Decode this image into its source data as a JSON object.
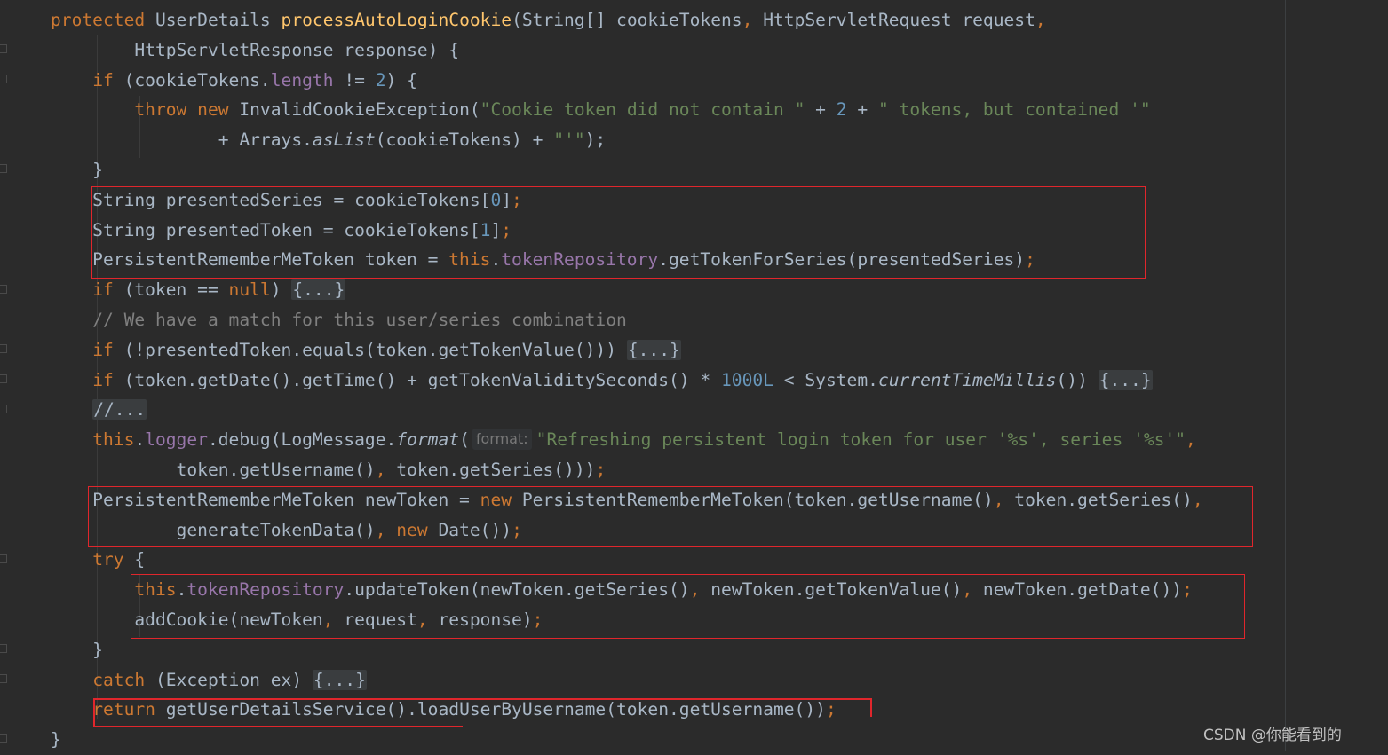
{
  "editor": {
    "lines": [
      [
        [
          "kw",
          "protected "
        ],
        [
          "pl",
          "UserDetails "
        ],
        [
          "fn",
          "processAutoLoginCookie"
        ],
        [
          "pl",
          "(String[] cookieTokens"
        ],
        [
          "kw",
          ", "
        ],
        [
          "pl",
          "HttpServletRequest request"
        ],
        [
          "kw",
          ","
        ]
      ],
      [
        [
          "pl",
          "        HttpServletResponse response) {"
        ]
      ],
      [
        [
          "pl",
          "    "
        ],
        [
          "kw",
          "if "
        ],
        [
          "pl",
          "(cookieTokens."
        ],
        [
          "fld",
          "length "
        ],
        [
          "pl",
          "!= "
        ],
        [
          "num",
          "2"
        ],
        [
          "pl",
          ") {"
        ]
      ],
      [
        [
          "pl",
          "        "
        ],
        [
          "kw",
          "throw new "
        ],
        [
          "pl",
          "InvalidCookieException("
        ],
        [
          "str",
          "\"Cookie token did not contain \" "
        ],
        [
          "pl",
          "+ "
        ],
        [
          "num",
          "2 "
        ],
        [
          "pl",
          "+ "
        ],
        [
          "str",
          "\" tokens, but contained '\""
        ]
      ],
      [
        [
          "pl",
          "                + Arrays."
        ],
        [
          "it",
          "asList"
        ],
        [
          "pl",
          "(cookieTokens) + "
        ],
        [
          "str",
          "\"'\""
        ],
        [
          "pl",
          ");"
        ]
      ],
      [
        [
          "pl",
          "    }"
        ]
      ],
      [
        [
          "pl",
          "    String presentedSeries = cookieTokens["
        ],
        [
          "num",
          "0"
        ],
        [
          "pl",
          "]"
        ],
        [
          "kw",
          ";"
        ]
      ],
      [
        [
          "pl",
          "    String presentedToken = cookieTokens["
        ],
        [
          "num",
          "1"
        ],
        [
          "pl",
          "]"
        ],
        [
          "kw",
          ";"
        ]
      ],
      [
        [
          "pl",
          "    PersistentRememberMeToken token = "
        ],
        [
          "kw",
          "this"
        ],
        [
          "pl",
          "."
        ],
        [
          "fld",
          "tokenRepository"
        ],
        [
          "pl",
          ".getTokenForSeries(presentedSeries)"
        ],
        [
          "kw",
          ";"
        ]
      ],
      [
        [
          "pl",
          "    "
        ],
        [
          "kw",
          "if "
        ],
        [
          "pl",
          "(token == "
        ],
        [
          "kw",
          "null"
        ],
        [
          "pl",
          ") "
        ],
        [
          "fold",
          "{...}"
        ]
      ],
      [
        [
          "pl",
          "    "
        ],
        [
          "cmt",
          "// We have a match for this user/series combination"
        ]
      ],
      [
        [
          "pl",
          "    "
        ],
        [
          "kw",
          "if "
        ],
        [
          "pl",
          "(!presentedToken.equals(token.getTokenValue())) "
        ],
        [
          "fold",
          "{...}"
        ]
      ],
      [
        [
          "pl",
          "    "
        ],
        [
          "kw",
          "if "
        ],
        [
          "pl",
          "(token.getDate().getTime() + getTokenValiditySeconds() * "
        ],
        [
          "num",
          "1000L "
        ],
        [
          "pl",
          "< System."
        ],
        [
          "it",
          "currentTimeMillis"
        ],
        [
          "pl",
          "()) "
        ],
        [
          "fold",
          "{...}"
        ]
      ],
      [
        [
          "pl",
          "    "
        ],
        [
          "fold",
          "//..."
        ]
      ],
      [
        [
          "pl",
          "    "
        ],
        [
          "kw",
          "this"
        ],
        [
          "pl",
          "."
        ],
        [
          "fld",
          "logger"
        ],
        [
          "pl",
          ".debug(LogMessage."
        ],
        [
          "it",
          "format"
        ],
        [
          "pl",
          "("
        ],
        [
          "hint",
          "format:"
        ],
        [
          "str",
          "\"Refreshing persistent login token for user '%s', series '%s'\""
        ],
        [
          "kw",
          ","
        ]
      ],
      [
        [
          "pl",
          "            token.getUsername()"
        ],
        [
          "kw",
          ", "
        ],
        [
          "pl",
          "token.getSeries()))"
        ],
        [
          "kw",
          ";"
        ]
      ],
      [
        [
          "pl",
          "    PersistentRememberMeToken newToken = "
        ],
        [
          "kw",
          "new "
        ],
        [
          "pl",
          "PersistentRememberMeToken(token.getUsername()"
        ],
        [
          "kw",
          ", "
        ],
        [
          "pl",
          "token.getSeries()"
        ],
        [
          "kw",
          ","
        ]
      ],
      [
        [
          "pl",
          "            generateTokenData()"
        ],
        [
          "kw",
          ", new "
        ],
        [
          "pl",
          "Date())"
        ],
        [
          "kw",
          ";"
        ]
      ],
      [
        [
          "pl",
          "    "
        ],
        [
          "kw",
          "try "
        ],
        [
          "pl",
          "{"
        ]
      ],
      [
        [
          "pl",
          "        "
        ],
        [
          "kw",
          "this"
        ],
        [
          "pl",
          "."
        ],
        [
          "fld",
          "tokenRepository"
        ],
        [
          "pl",
          ".updateToken(newToken.getSeries()"
        ],
        [
          "kw",
          ", "
        ],
        [
          "pl",
          "newToken.getTokenValue()"
        ],
        [
          "kw",
          ", "
        ],
        [
          "pl",
          "newToken.getDate())"
        ],
        [
          "kw",
          ";"
        ]
      ],
      [
        [
          "pl",
          "        addCookie(newToken"
        ],
        [
          "kw",
          ", "
        ],
        [
          "pl",
          "request"
        ],
        [
          "kw",
          ", "
        ],
        [
          "pl",
          "response)"
        ],
        [
          "kw",
          ";"
        ]
      ],
      [
        [
          "pl",
          "    }"
        ]
      ],
      [
        [
          "pl",
          "    "
        ],
        [
          "kw",
          "catch "
        ],
        [
          "pl",
          "(Exception ex) "
        ],
        [
          "fold",
          "{...}"
        ]
      ],
      [
        [
          "pl",
          "    "
        ],
        [
          "kw",
          "return "
        ],
        [
          "pl",
          "getUserDetailsService().loadUserByUsername(token.getUsername())"
        ],
        [
          "kw",
          ";"
        ]
      ],
      [
        [
          "pl",
          "}"
        ]
      ]
    ]
  },
  "watermark": {
    "csdn_label": "CSDN @你能看到的"
  },
  "colors": {
    "background": "#2b2b2b",
    "keyword": "#cc7832",
    "method_decl": "#ffc66d",
    "string": "#6a8759",
    "number": "#6897bb",
    "field": "#9876aa",
    "comment": "#808080",
    "plain": "#a9b7c6",
    "highlight_box": "#e0262c"
  }
}
